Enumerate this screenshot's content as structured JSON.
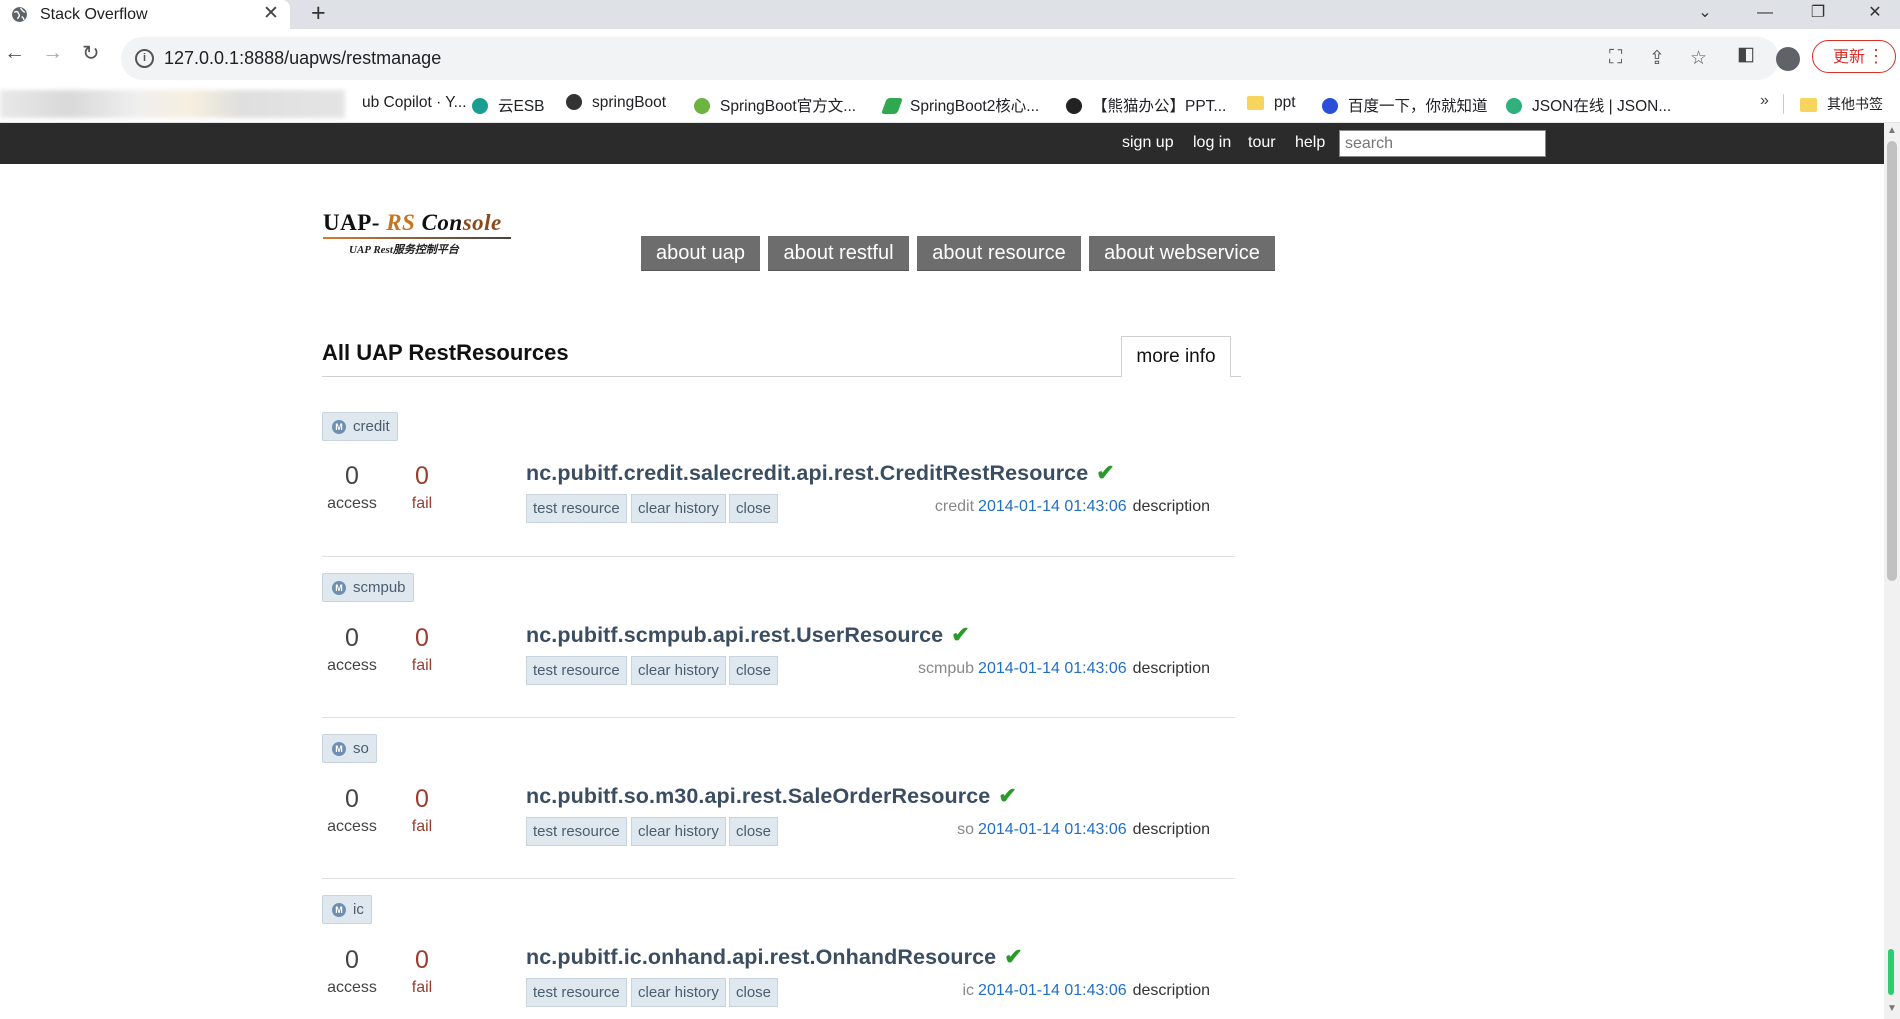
{
  "browser": {
    "tab_title": "Stack Overflow",
    "url": "127.0.0.1:8888/uapws/restmanage",
    "update_label": "更新",
    "bookmarks": [
      {
        "label": "ub Copilot · Y..."
      },
      {
        "label": "云ESB"
      },
      {
        "label": "springBoot"
      },
      {
        "label": "SpringBoot官方文..."
      },
      {
        "label": "SpringBoot2核心..."
      },
      {
        "label": "【熊猫办公】PPT..."
      },
      {
        "label": "ppt"
      },
      {
        "label": "百度一下，你就知道"
      },
      {
        "label": "JSON在线 | JSON..."
      }
    ],
    "other_bookmarks": "其他书签",
    "more_symbol": "»"
  },
  "topbar": {
    "links": [
      "sign up",
      "log in",
      "tour",
      "help"
    ],
    "search_placeholder": "search"
  },
  "logo": {
    "part1": "UAP- ",
    "part2": "RS",
    "part3": " Con",
    "part4": "sole",
    "subtitle": "UAP Rest服务控制平台"
  },
  "nav": [
    "about uap",
    "about restful",
    "about resource",
    "about webservice"
  ],
  "section": {
    "title": "All UAP RestResources",
    "more_info": "more info"
  },
  "labels": {
    "access": "access",
    "fail": "fail",
    "test": "test resource",
    "clear": "clear history",
    "close": "close",
    "description": "description"
  },
  "resources": [
    {
      "tag": "credit",
      "access": "0",
      "fail": "0",
      "name": "nc.pubitf.credit.salecredit.api.rest.CreditRestResource",
      "module": "credit",
      "time": "2014-01-14 01:43:06"
    },
    {
      "tag": "scmpub",
      "access": "0",
      "fail": "0",
      "name": "nc.pubitf.scmpub.api.rest.UserResource",
      "module": "scmpub",
      "time": "2014-01-14 01:43:06"
    },
    {
      "tag": "so",
      "access": "0",
      "fail": "0",
      "name": "nc.pubitf.so.m30.api.rest.SaleOrderResource",
      "module": "so",
      "time": "2014-01-14 01:43:06"
    },
    {
      "tag": "ic",
      "access": "0",
      "fail": "0",
      "name": "nc.pubitf.ic.onhand.api.rest.OnhandResource",
      "module": "ic",
      "time": "2014-01-14 01:43:06"
    }
  ]
}
